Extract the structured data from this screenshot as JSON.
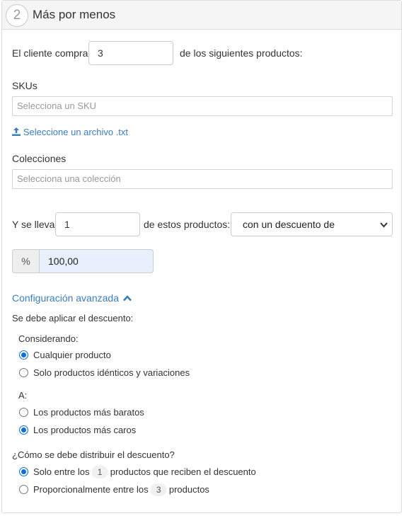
{
  "header": {
    "step_number": "2",
    "title": "Más por menos"
  },
  "buy": {
    "prefix": "El cliente compra",
    "quantity": "3",
    "suffix": "de los siguientes productos:"
  },
  "skus": {
    "label": "SKUs",
    "placeholder": "Selecciona un SKU",
    "upload_link": "Seleccione un archivo .txt"
  },
  "collections": {
    "label": "Colecciones",
    "placeholder": "Selecciona una colección"
  },
  "get": {
    "prefix": "Y se lleva",
    "quantity": "1",
    "suffix": "de estos productos:",
    "discount_type": "con un descuento de"
  },
  "discount": {
    "unit": "%",
    "value": "100,00"
  },
  "advanced": {
    "toggle_label": "Configuración avanzada",
    "apply_heading": "Se debe aplicar el descuento:",
    "considering_label": "Considerando:",
    "considering_options": [
      "Cualquier producto",
      "Solo productos idénticos y variaciones"
    ],
    "considering_selected": "Cualquier producto",
    "target_label": "A:",
    "target_options": [
      "Los productos más baratos",
      "Los productos más caros"
    ],
    "target_selected": "Los productos más caros",
    "distribution_question": "¿Cómo se debe distribuir el descuento?",
    "distribution_option_1": {
      "prefix": "Solo entre los",
      "count": "1",
      "suffix": "productos que reciben el descuento"
    },
    "distribution_option_2": {
      "prefix": "Proporcionalmente entre los",
      "count": "3",
      "suffix": "productos"
    },
    "distribution_selected": "option_1"
  },
  "colors": {
    "accent": "#3c7dbd",
    "radio_selected": "#0a6fd6",
    "input_highlight": "#e8f0fe"
  },
  "icons": {
    "upload": "upload-icon",
    "chevron": "chevron-up-icon",
    "dropdown": "chevron-down-icon"
  }
}
